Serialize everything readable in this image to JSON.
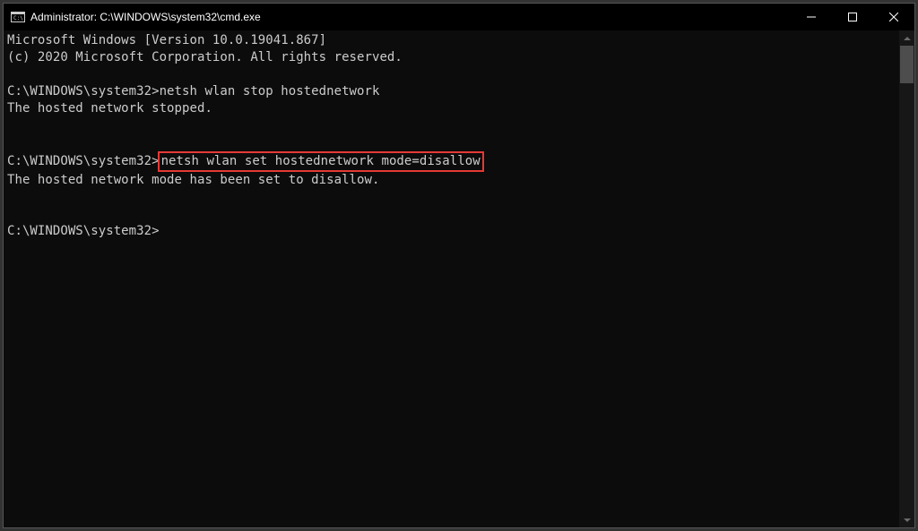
{
  "window": {
    "title": "Administrator: C:\\WINDOWS\\system32\\cmd.exe"
  },
  "terminal": {
    "lines": [
      {
        "text": "Microsoft Windows [Version 10.0.19041.867]"
      },
      {
        "text": "(c) 2020 Microsoft Corporation. All rights reserved."
      },
      {
        "text": ""
      },
      {
        "prompt": "C:\\WINDOWS\\system32>",
        "cmd": "netsh wlan stop hostednetwork"
      },
      {
        "text": "The hosted network stopped."
      },
      {
        "text": ""
      },
      {
        "text": ""
      },
      {
        "prompt": "C:\\WINDOWS\\system32>",
        "cmd": "netsh wlan set hostednetwork mode=disallow",
        "highlight": true
      },
      {
        "text": "The hosted network mode has been set to disallow."
      },
      {
        "text": ""
      },
      {
        "text": ""
      },
      {
        "prompt": "C:\\WINDOWS\\system32>",
        "cmd": ""
      }
    ]
  }
}
